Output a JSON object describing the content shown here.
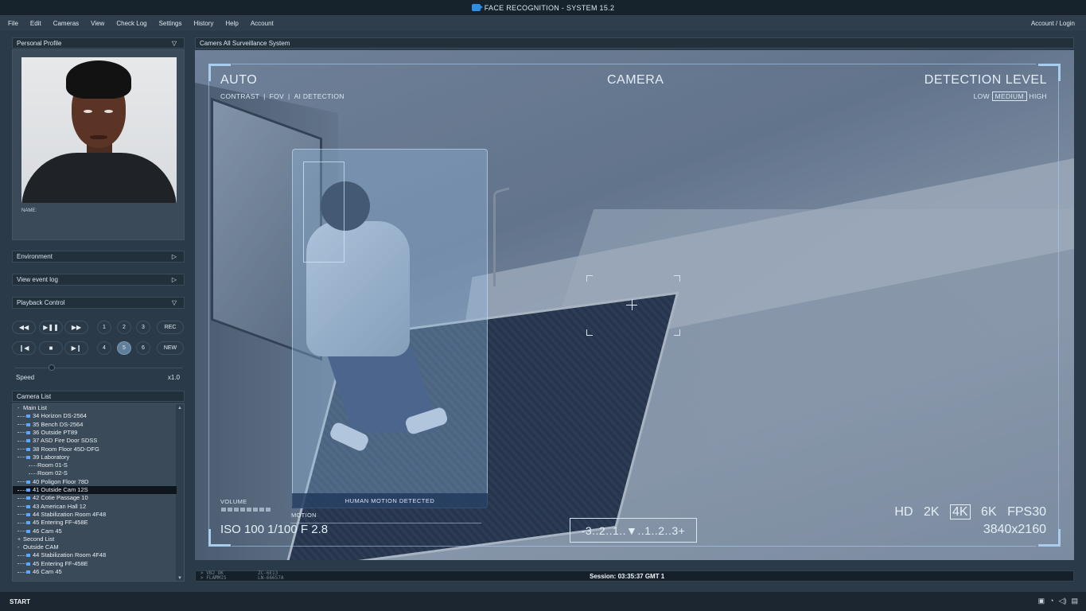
{
  "window": {
    "title": "FACE RECOGNITION - SYSTEM 15.2"
  },
  "menu": {
    "items": [
      "File",
      "Edit",
      "Cameras",
      "View",
      "Check Log",
      "Settings",
      "History",
      "Help",
      "Account"
    ],
    "account_login": "Account / Login"
  },
  "profile": {
    "header": "Personal Profile",
    "name_label": "NAME:"
  },
  "sections": {
    "environment": "Environment",
    "event_log": "View event log",
    "playback": "Playback Control"
  },
  "playback": {
    "row1_numbers": [
      "1",
      "2",
      "3"
    ],
    "row2_numbers": [
      "4",
      "5",
      "6"
    ],
    "active_number": "5",
    "rec_label": "REC",
    "new_label": "NEW",
    "speed_label": "Speed",
    "speed_value": "x1.0"
  },
  "camera_list": {
    "header": "Camera List",
    "rows": [
      {
        "label": "Main List",
        "kind": "group",
        "toggle": "-"
      },
      {
        "label": "34 Horizon DS-2564",
        "kind": "cam"
      },
      {
        "label": "35 Bench DS-2564",
        "kind": "cam"
      },
      {
        "label": "36 Outside PT89",
        "kind": "cam"
      },
      {
        "label": "37 ASD Fire Door SDSS",
        "kind": "cam"
      },
      {
        "label": "38 Room Floor 45D-DFG",
        "kind": "cam"
      },
      {
        "label": "39 Laboratory",
        "kind": "cam",
        "toggle": "-"
      },
      {
        "label": "Room 01-S",
        "kind": "sub"
      },
      {
        "label": "Room 02-S",
        "kind": "sub"
      },
      {
        "label": "40 Poligon Floor 78D",
        "kind": "cam"
      },
      {
        "label": "41 Outside Cam 12S",
        "kind": "cam",
        "selected": true
      },
      {
        "label": "42 Cotie Passage 10",
        "kind": "cam"
      },
      {
        "label": "43 American Hall 12",
        "kind": "cam"
      },
      {
        "label": "44 Stabilization Room 4F48",
        "kind": "cam"
      },
      {
        "label": "45 Entering FF-458E",
        "kind": "cam"
      },
      {
        "label": "46 Cam 45",
        "kind": "cam"
      },
      {
        "label": "Second List",
        "kind": "group",
        "toggle": "+"
      },
      {
        "label": "Outside CAM",
        "kind": "group",
        "toggle": "-"
      },
      {
        "label": "44 Stabilization Room 4F48",
        "kind": "cam"
      },
      {
        "label": "45 Entering FF-458E",
        "kind": "cam"
      },
      {
        "label": "46 Cam 45",
        "kind": "cam"
      }
    ]
  },
  "viewer": {
    "header": "Camers All Surveillance System",
    "auto": "AUTO",
    "camera": "CAMERA",
    "detection_level": "DETECTION LEVEL",
    "auto_options": [
      "CONTRAST",
      "FOV",
      "AI DETECTION"
    ],
    "levels": [
      "LOW",
      "MEDIUM",
      "HIGH"
    ],
    "active_level": "MEDIUM",
    "detection_label": "HUMAN MOTION DETECTED",
    "volume_label": "VOLUME",
    "motion_label": "MOTION",
    "exposure_scale": "-3..2..1..▼..1..2..3+",
    "iso": "ISO 100 1/100 F 2.8",
    "resolutions": [
      "HD",
      "2K",
      "4K",
      "6K",
      "FPS30"
    ],
    "active_resolution": "4K",
    "resolution_size": "3840x2160"
  },
  "status": {
    "codes_left": [
      "> VB2_OK",
      "> FLAMMIS"
    ],
    "codes_right": [
      "ZC-6E13",
      "LN-66657A"
    ],
    "session": "Session: 03:35:37 GMT 1"
  },
  "taskbar": {
    "start": "START"
  },
  "icons": {
    "app": "camera-app-icon",
    "tray": [
      "camera-tray-icon",
      "wifi-icon",
      "volume-icon",
      "notification-icon"
    ]
  },
  "colors": {
    "accent": "#2f8de4",
    "selected_row": "#0e151c",
    "hud": "#a8cdee"
  }
}
